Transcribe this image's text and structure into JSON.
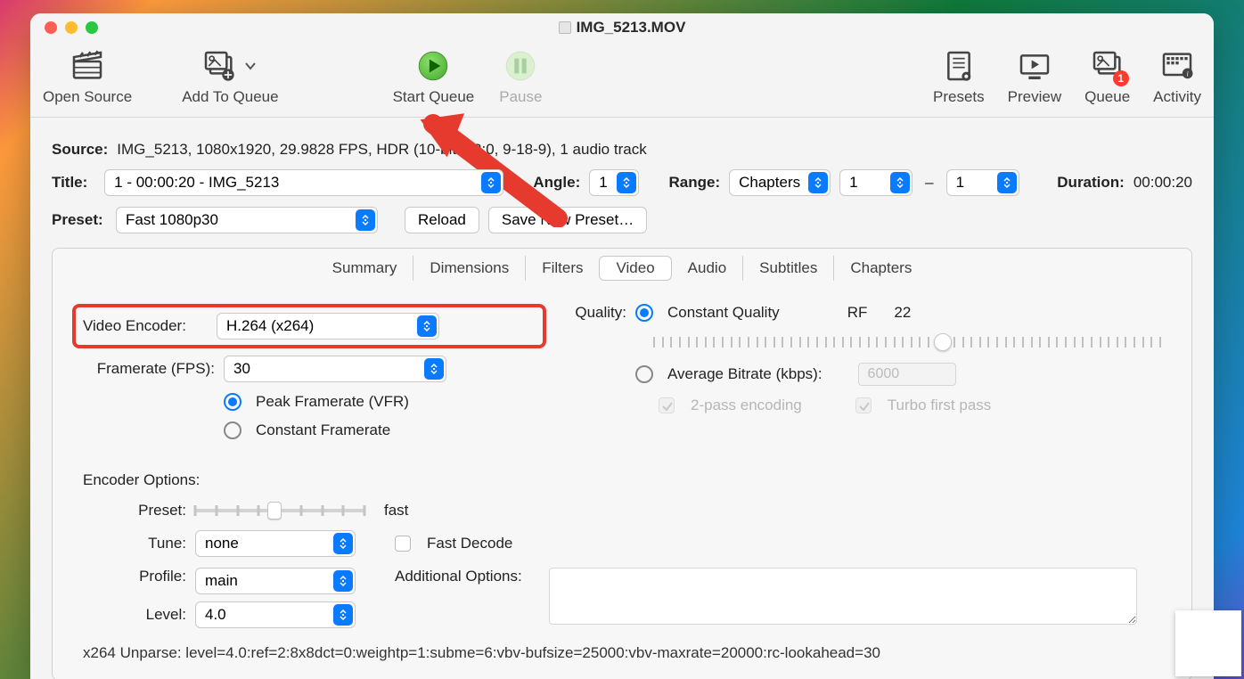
{
  "window": {
    "title": "IMG_5213.MOV"
  },
  "toolbar": {
    "open_source": "Open Source",
    "add_to_queue": "Add To Queue",
    "start_queue": "Start Queue",
    "pause": "Pause",
    "presets": "Presets",
    "preview": "Preview",
    "queue": "Queue",
    "queue_badge": "1",
    "activity": "Activity"
  },
  "source": {
    "label": "Source:",
    "value": "IMG_5213, 1080x1920, 29.9828 FPS, HDR (10-bit 4:2:0, 9-18-9), 1 audio track"
  },
  "title_row": {
    "label": "Title:",
    "value": "1 - 00:00:20 - IMG_5213",
    "angle_label": "Angle:",
    "angle": "1",
    "range_label": "Range:",
    "range_type": "Chapters",
    "range_from": "1",
    "range_to": "1",
    "duration_label": "Duration:",
    "duration": "00:00:20"
  },
  "preset_row": {
    "label": "Preset:",
    "value": "Fast 1080p30",
    "reload": "Reload",
    "save_new": "Save New Preset…"
  },
  "tabs": {
    "summary": "Summary",
    "dimensions": "Dimensions",
    "filters": "Filters",
    "video": "Video",
    "audio": "Audio",
    "subtitles": "Subtitles",
    "chapters": "Chapters"
  },
  "video": {
    "encoder_label": "Video Encoder:",
    "encoder": "H.264 (x264)",
    "framerate_label": "Framerate (FPS):",
    "framerate": "30",
    "peak_vfr": "Peak Framerate (VFR)",
    "constant_fr": "Constant Framerate",
    "quality_label": "Quality:",
    "cq": "Constant Quality",
    "rf_label": "RF",
    "rf_value": "22",
    "ab": "Average Bitrate (kbps):",
    "ab_value": "6000",
    "twopass": "2-pass encoding",
    "turbo": "Turbo first pass"
  },
  "encoder_options": {
    "heading": "Encoder Options:",
    "preset_label": "Preset:",
    "preset_value": "fast",
    "tune_label": "Tune:",
    "tune": "none",
    "fast_decode": "Fast Decode",
    "profile_label": "Profile:",
    "profile": "main",
    "additional_label": "Additional Options:",
    "level_label": "Level:",
    "level": "4.0"
  },
  "unparse": "x264 Unparse: level=4.0:ref=2:8x8dct=0:weightp=1:subme=6:vbv-bufsize=25000:vbv-maxrate=20000:rc-lookahead=30"
}
